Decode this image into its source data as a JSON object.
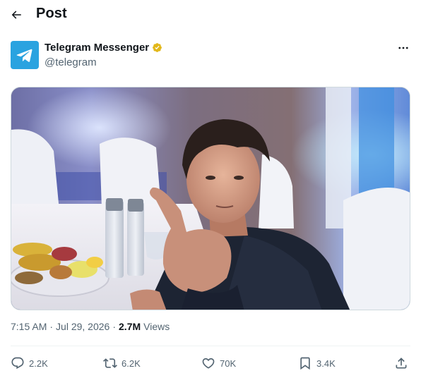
{
  "header": {
    "title": "Post"
  },
  "author": {
    "name": "Telegram Messenger",
    "handle": "@telegram",
    "verified_color": "#e2b719",
    "avatar_color": "#2aa3e0"
  },
  "post": {
    "time": "7:15 AM",
    "date": "Jul 29, 2026",
    "views_count": "2.7M",
    "views_label": "Views",
    "media_description_icon": "photo"
  },
  "actions": {
    "replies": "2.2K",
    "reposts": "6.2K",
    "likes": "70K",
    "bookmarks": "3.4K"
  },
  "icons": {
    "back": "back-arrow-icon",
    "more": "more-dots-icon",
    "reply": "reply-icon",
    "repost": "repost-icon",
    "like": "heart-icon",
    "bookmark": "bookmark-icon",
    "share": "share-icon"
  }
}
